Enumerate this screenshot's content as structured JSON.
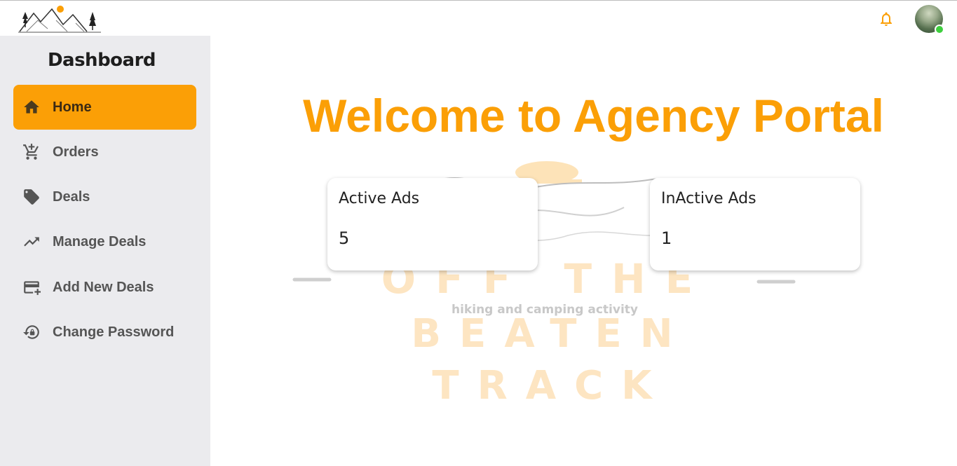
{
  "header": {
    "logo_icon": "mountains-logo-icon",
    "notification_icon": "bell-icon",
    "avatar": "user-avatar",
    "accent_color": "#fb9f06",
    "online_color": "#3ecf3e"
  },
  "sidebar": {
    "title": "Dashboard",
    "items": [
      {
        "label": "Home",
        "icon": "home-icon",
        "active": true
      },
      {
        "label": "Orders",
        "icon": "add-cart-icon",
        "active": false
      },
      {
        "label": "Deals",
        "icon": "tag-icon",
        "active": false
      },
      {
        "label": "Manage Deals",
        "icon": "trending-up-icon",
        "active": false
      },
      {
        "label": "Add New Deals",
        "icon": "add-card-icon",
        "active": false
      },
      {
        "label": "Change Password",
        "icon": "lock-reset-icon",
        "active": false
      }
    ]
  },
  "main": {
    "welcome": "Welcome to Agency Portal",
    "cards": [
      {
        "title": "Active Ads",
        "value": "5"
      },
      {
        "title": "InActive Ads",
        "value": "1"
      }
    ],
    "watermark": {
      "line1": "OFF THE",
      "tagline": "hiking and camping activity",
      "line2": "BEATEN",
      "line3": "TRACK"
    }
  }
}
